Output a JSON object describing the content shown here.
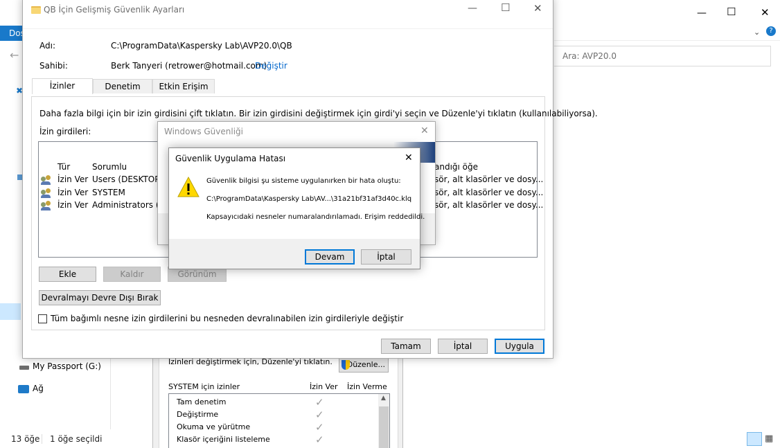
{
  "explorer": {
    "title_visible_text": "",
    "ribbon_tab": "Dos",
    "search_placeholder": "Ara: AVP20.0",
    "nav_items": [
      {
        "label": "My Passport (G:)",
        "icon": "drive-icon"
      },
      {
        "label": "Ağ",
        "icon": "network-icon"
      }
    ],
    "status_items": "13 öğe",
    "status_selected": "1 öğe seçildi",
    "window_controls": {
      "minimize": "—",
      "maximize": "☐",
      "close": "✕"
    }
  },
  "props": {
    "edit_hint": "İzinleri değiştirmek için, Düzenle'yi tıklatın.",
    "edit_button": "Düzenle...",
    "perm_header": "SYSTEM için izinler",
    "allow_col": "İzin Ver",
    "deny_col": "İzin Verme",
    "perms": [
      "Tam denetim",
      "Değiştirme",
      "Okuma ve yürütme",
      "Klasör içeriğini listeleme"
    ]
  },
  "advanced": {
    "title": "QB İçin Gelişmiş Güvenlik Ayarları",
    "name_label": "Adı:",
    "name_value": "C:\\ProgramData\\Kaspersky Lab\\AVP20.0\\QB",
    "owner_label": "Sahibi:",
    "owner_value": "Berk Tanyeri (retrower@hotmail.com)",
    "change_link": "Değiştir",
    "tabs": [
      "İzinler",
      "Denetim",
      "Etkin Erişim"
    ],
    "info_text": "Daha fazla bilgi için bir izin girdisini çift tıklatın. Bir izin girdisini değiştirmek için girdi'yi seçin ve Düzenle'yi tıklatın (kullanılabiliyorsa).",
    "entries_label": "İzin girdileri:",
    "columns": {
      "type": "Tür",
      "principal": "Sorumlu",
      "applies": "andığı öğe"
    },
    "rows": [
      {
        "type": "İzin Ver",
        "principal": "Users (DESKTOP-G",
        "applies": "sör, alt klasörler ve dosy..."
      },
      {
        "type": "İzin Ver",
        "principal": "SYSTEM",
        "applies": "sör, alt klasörler ve dosy..."
      },
      {
        "type": "İzin Ver",
        "principal": "Administrators (DE",
        "applies": "sör, alt klasörler ve dosy..."
      }
    ],
    "add_button": "Ekle",
    "remove_button": "Kaldır",
    "view_button": "Görünüm",
    "disable_inherit_button": "Devralmayı Devre Dışı Bırak",
    "replace_checkbox_label": "Tüm bağımlı nesne izin girdilerini bu nesneden devralınabilen izin girdileriyle değiştir",
    "ok_button": "Tamam",
    "cancel_button": "İptal",
    "apply_button": "Uygula"
  },
  "winsec": {
    "title": "Windows Güvenliği"
  },
  "error": {
    "title": "Güvenlik Uygulama Hatası",
    "line1": "Güvenlik bilgisi şu sisteme uygulanırken bir hata oluştu:",
    "line2": "C:\\ProgramData\\Kaspersky Lab\\AV...\\31a21bf31af3d40c.klq",
    "line3": "Kapsayıcıdaki nesneler numaralandırılamadı. Erişim reddedildi.",
    "continue_button": "Devam",
    "cancel_button": "İptal",
    "icon": "warning-icon"
  },
  "colors": {
    "accent": "#0078d7",
    "link": "#0066cc",
    "warning": "#ffd800"
  }
}
